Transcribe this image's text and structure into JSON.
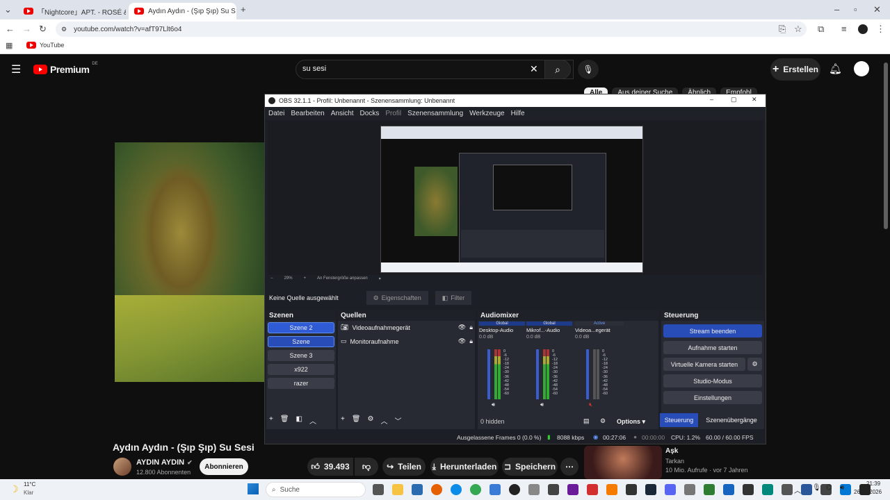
{
  "browser": {
    "tabs": [
      {
        "title": "「Nightcore」APT. - ROSÉ & Bru"
      },
      {
        "title": "Aydın Aydın - (Şıp Şıp) Su S"
      }
    ],
    "url": "youtube.com/watch?v=afT97Llt6o4",
    "bookmark": "YouTube"
  },
  "youtube": {
    "logo": "Premium",
    "region": "DE",
    "search_query": "su sesi",
    "create_label": "Erstellen",
    "chips": [
      "Alle",
      "Aus deiner Suche",
      "Ähnlich",
      "Empfohl"
    ],
    "video_title": "Aydın Aydın - (Şıp Şıp) Su Sesi",
    "channel": "AYDIN AYDIN",
    "subscribers": "12.800 Abonnenten",
    "subscribe": "Abonnieren",
    "likes": "39.493",
    "share": "Teilen",
    "download": "Herunterladen",
    "save": "Speichern",
    "side": {
      "title": "Aşk",
      "channel": "Tarkan",
      "meta": "10 Mio. Aufrufe · vor 7 Jahren"
    }
  },
  "obs": {
    "title": "OBS 32.1.1 - Profil: Unbenannt - Szenensammlung: Unbenannt",
    "menu": [
      "Datei",
      "Bearbeiten",
      "Ansicht",
      "Docks",
      "Profil",
      "Szenensammlung",
      "Werkzeuge",
      "Hilfe"
    ],
    "zoom": "29%",
    "fit": "An Fenstergröße anpassen",
    "no_source": "Keine Quelle ausgewählt",
    "properties": "Eigenschaften",
    "filter": "Filter",
    "scenes_title": "Szenen",
    "scenes": [
      "Szene 2",
      "Szene",
      "Szene 3",
      "x922",
      "razer"
    ],
    "sources_title": "Quellen",
    "sources": [
      "Videoaufnahmegerät",
      "Monitoraufnahme"
    ],
    "mixer_title": "Audiomixer",
    "mixer": [
      {
        "tag": "Global",
        "name": "Desktop-Audio",
        "db": "0.0 dB"
      },
      {
        "tag": "Global",
        "name": "Mikrof...-Audio",
        "db": "0.0 dB"
      },
      {
        "tag": "Active",
        "name": "Videoa...egerät",
        "db": "0.0 dB"
      }
    ],
    "ticks": [
      "0",
      "-6",
      "-12",
      "-18",
      "-24",
      "-30",
      "-36",
      "-42",
      "-48",
      "-54",
      "-60"
    ],
    "hidden": "0 hidden",
    "options": "Options",
    "control_title": "Steuerung",
    "controls": [
      "Stream beenden",
      "Aufnahme starten",
      "Virtuelle Kamera starten",
      "Studio-Modus",
      "Einstellungen"
    ],
    "tabs": [
      "Steuerung",
      "Szenenübergänge"
    ],
    "status": {
      "dropped": "Ausgelassene Frames 0 (0.0 %)",
      "kbps": "8088 kbps",
      "stream_time": "00:27:06",
      "rec_time": "00:00:00",
      "cpu": "CPU: 1.2%",
      "fps": "60.00 / 60.00 FPS"
    }
  },
  "taskbar": {
    "temp": "11°C",
    "weather": "Klar",
    "search": "Suche",
    "time": "21:39",
    "date": "26.04.2026"
  }
}
